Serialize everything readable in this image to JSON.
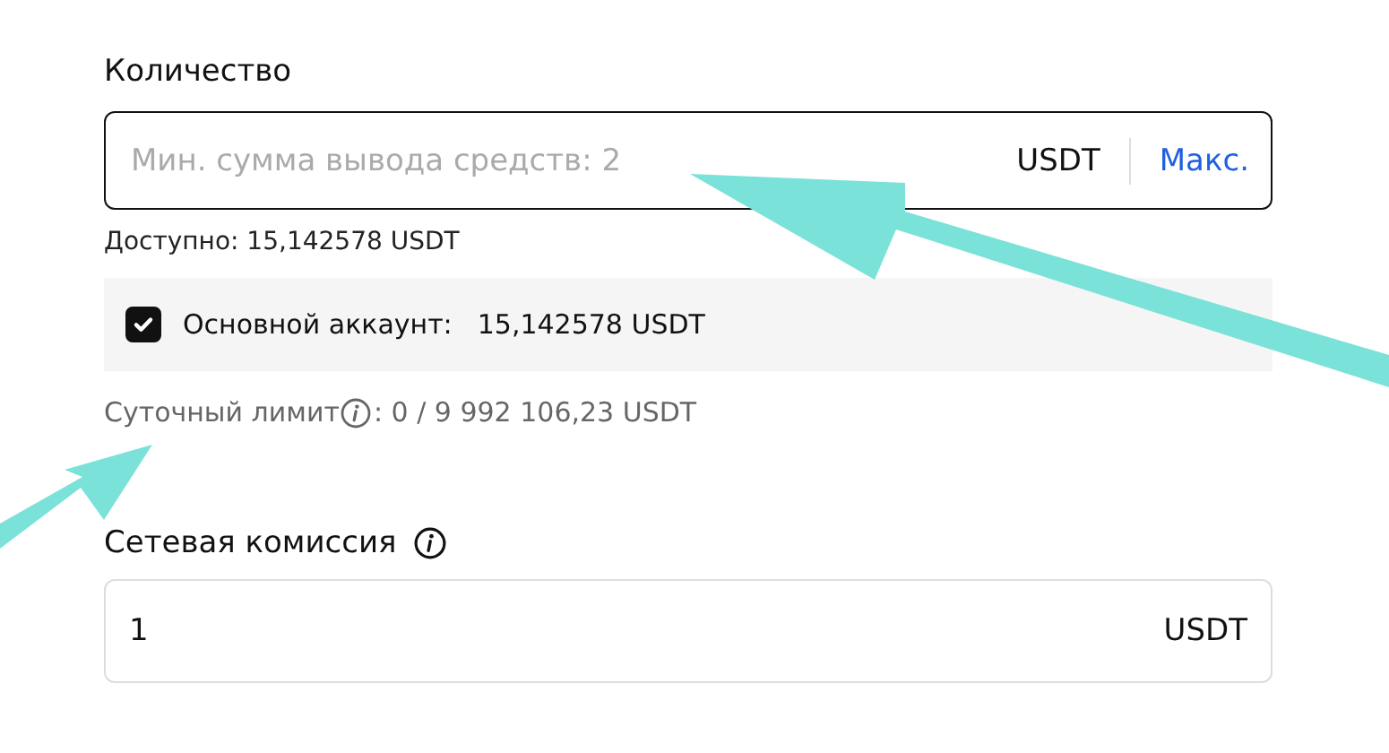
{
  "amount": {
    "label": "Количество",
    "placeholder": "Мин. сумма вывода средств: 2",
    "currency": "USDT",
    "max_link": "Макс."
  },
  "available": "Доступно: 15,142578 USDT",
  "account": {
    "checked": true,
    "label": "Основной аккаунт:",
    "value": "15,142578 USDT"
  },
  "daily_limit": {
    "label": "Суточный лимит",
    "value": ": 0 / 9 992 106,23 USDT"
  },
  "fee": {
    "label": "Сетевая комиссия",
    "value": "1",
    "currency": "USDT"
  }
}
